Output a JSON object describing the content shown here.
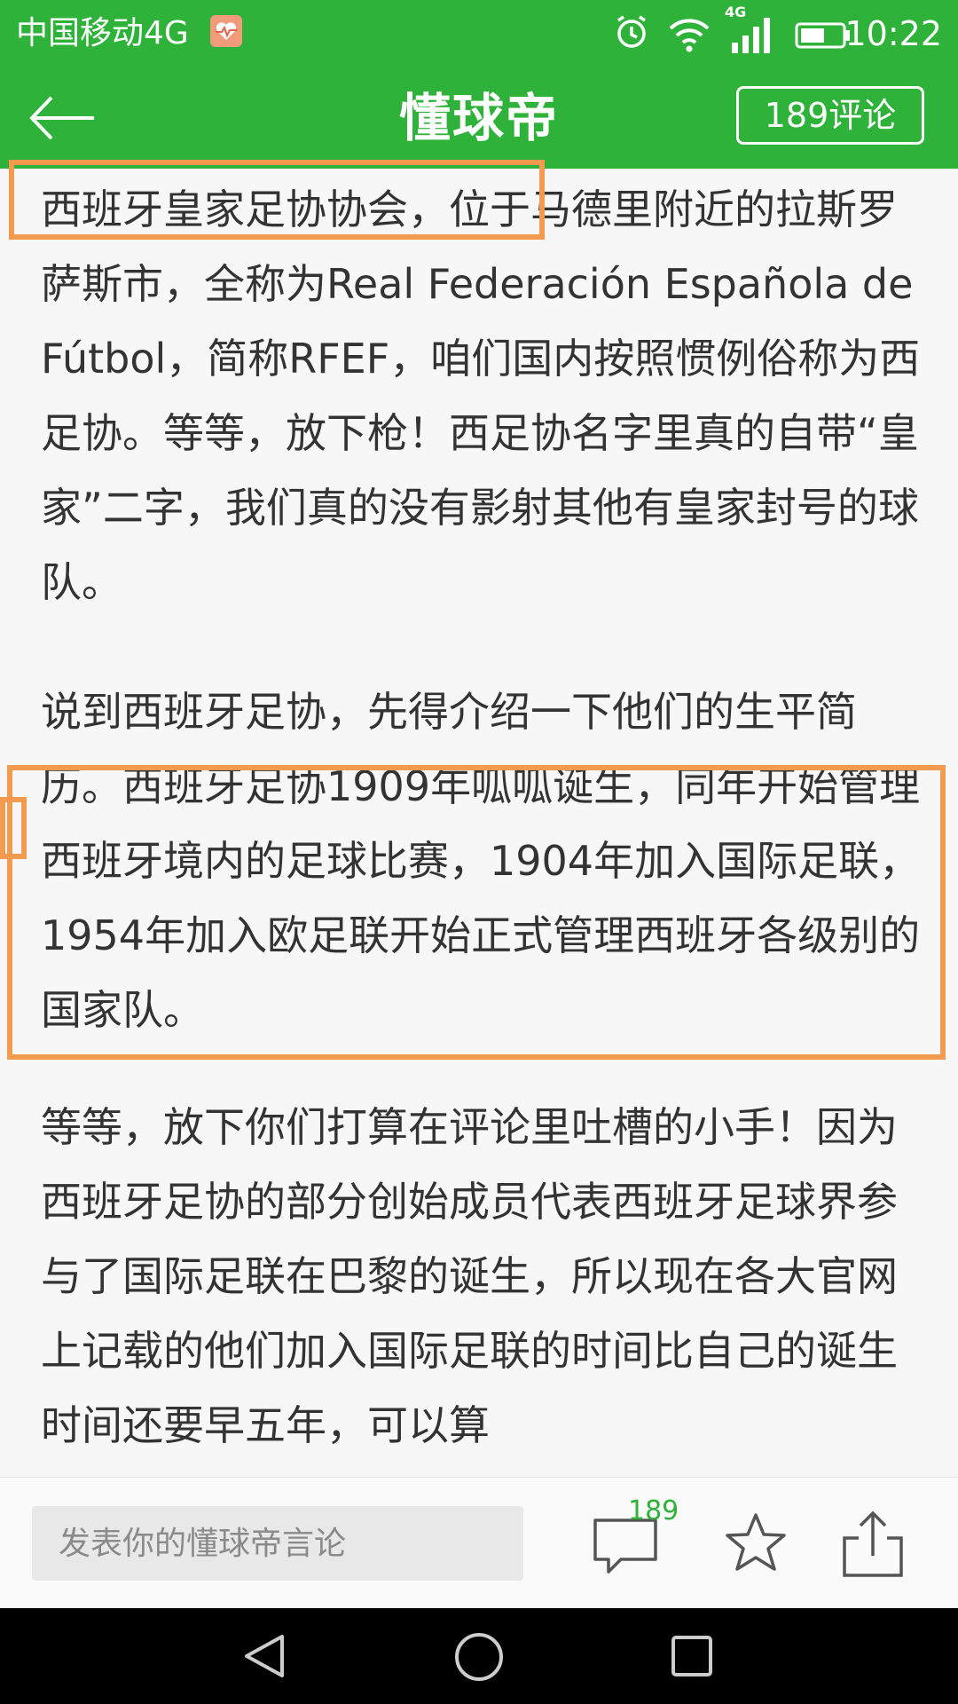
{
  "status_bar": {
    "carrier": "中国移动4G",
    "network_badge": "4G",
    "time": "10:22"
  },
  "app_bar": {
    "title": "懂球帝",
    "comments_button_label": "189评论"
  },
  "article": {
    "paragraphs": [
      "西班牙皇家足协协会，位于马德里附近的拉斯罗萨斯市，全称为Real Federación Española de Fútbol，简称RFEF，咱们国内按照惯例俗称为西足协。等等，放下枪！西足协名字里真的自带“皇家”二字，我们真的没有影射其他有皇家封号的球队。",
      "说到西班牙足协，先得介绍一下他们的生平简历。西班牙足协1909年呱呱诞生，同年开始管理西班牙境内的足球比赛，1904年加入国际足联，1954年加入欧足联开始正式管理西班牙各级别的国家队。",
      "等等，放下你们打算在评论里吐槽的小手！因为西班牙足协的部分创始成员代表西班牙足球界参与了国际足联在巴黎的诞生，所以现在各大官网上记载的他们加入国际足联的时间比自己的诞生时间还要早五年，可以算"
    ]
  },
  "action_bar": {
    "input_placeholder": "发表你的懂球帝言论",
    "comment_count": "189"
  },
  "icons": {
    "back": "arrow-left-icon",
    "comment": "speech-bubble-icon",
    "favorite": "star-icon",
    "share": "share-icon",
    "alarm": "alarm-clock-icon",
    "wifi": "wifi-icon",
    "signal": "cell-signal-icon",
    "battery": "battery-icon",
    "health": "health-app-icon",
    "nav_back": "nav-back-icon",
    "nav_home": "nav-home-icon",
    "nav_recent": "nav-recent-apps-icon"
  },
  "colors": {
    "brand_green": "#2fb23a",
    "annotation_orange": "#f29a4e",
    "background": "#f7f7f7",
    "text": "#333333"
  }
}
